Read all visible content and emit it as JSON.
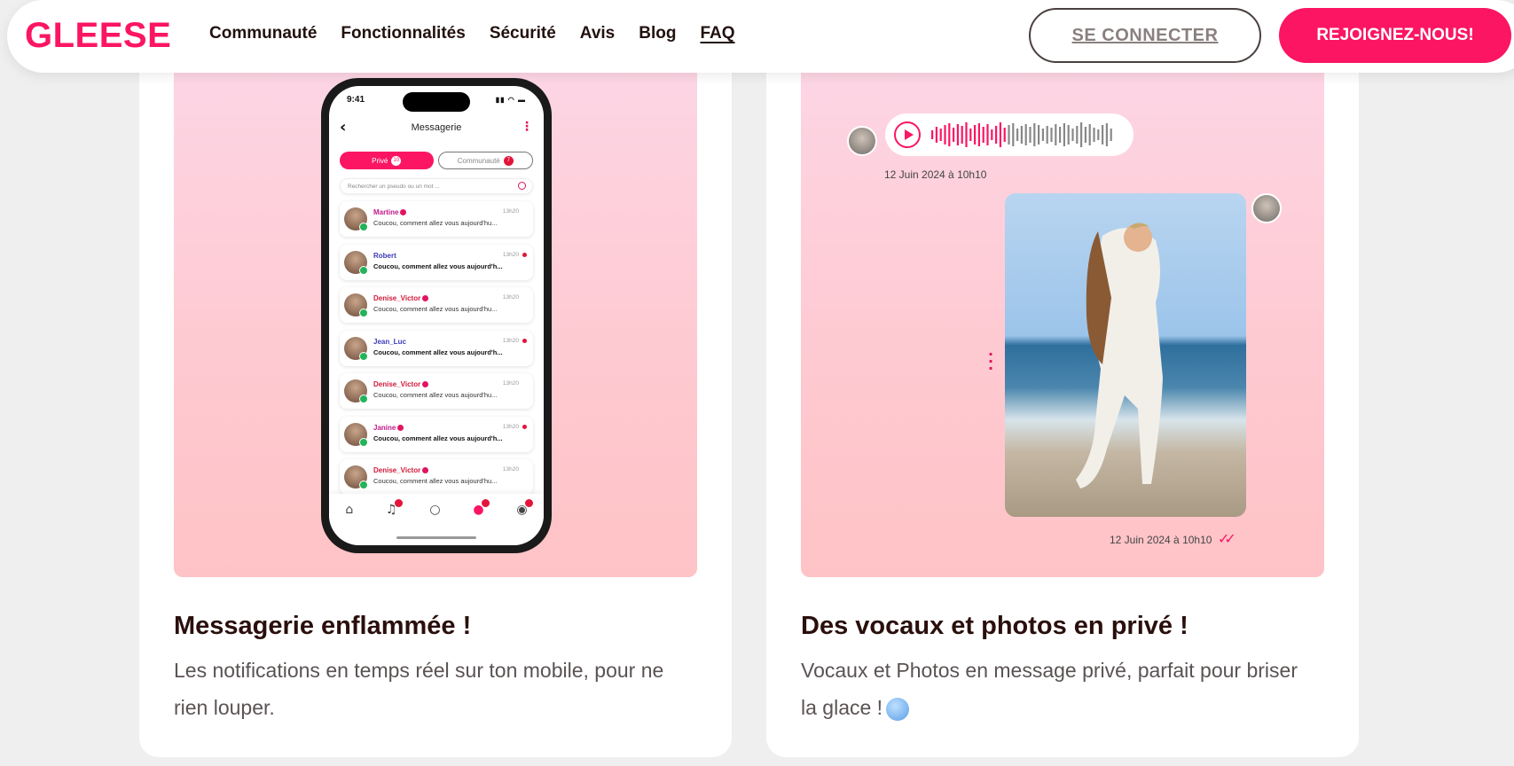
{
  "brand": {
    "logo": "GLEESE",
    "accent": "#fb1563"
  },
  "nav": {
    "items": [
      "Communauté",
      "Fonctionnalités",
      "Sécurité",
      "Avis",
      "Blog",
      "FAQ"
    ],
    "login": "SE CONNECTER",
    "join": "REJOIGNEZ-NOUS!"
  },
  "cards": [
    {
      "title": "Messagerie enflammée !",
      "text": "Les notifications en temps réel sur ton mobile, pour ne rien louper."
    },
    {
      "title": "Des vocaux et photos en privé !",
      "text": "Vocaux et Photos en message privé, parfait pour briser la glace !"
    }
  ],
  "phone": {
    "time": "9:41",
    "title": "Messagerie",
    "tab_private": "Privé",
    "tab_private_count": "10",
    "tab_community": "Communauté",
    "tab_community_count": "7",
    "search_placeholder": "Rechercher un pseudo ou un mot ...",
    "messages": [
      {
        "name": "Martine",
        "color": "#c2188a",
        "time": "13h20",
        "msg": "Coucou, comment allez vous aujourd'hu...",
        "unread": false
      },
      {
        "name": "Robert",
        "color": "#3b3bb5",
        "time": "13h20",
        "msg": "Coucou, comment allez vous aujourd'h...",
        "unread": true
      },
      {
        "name": "Denise_Victor",
        "color": "#d01a3a",
        "time": "13h20",
        "msg": "Coucou, comment allez vous aujourd'hu...",
        "unread": false
      },
      {
        "name": "Jean_Luc",
        "color": "#3b3bb5",
        "time": "13h20",
        "msg": "Coucou, comment allez vous aujourd'h...",
        "unread": true
      },
      {
        "name": "Denise_Victor",
        "color": "#d01a3a",
        "time": "13h20",
        "msg": "Coucou, comment allez vous aujourd'hu...",
        "unread": false
      },
      {
        "name": "Janine",
        "color": "#c2188a",
        "time": "13h20",
        "msg": "Coucou, comment allez vous aujourd'h...",
        "unread": true
      },
      {
        "name": "Denise_Victor",
        "color": "#d01a3a",
        "time": "13h20",
        "msg": "Coucou, comment allez vous aujourd'hu...",
        "unread": false
      }
    ]
  },
  "voice": {
    "voice_time": "12 Juin 2024 à 10h10",
    "photo_time": "12 Juin 2024 à 10h10"
  }
}
